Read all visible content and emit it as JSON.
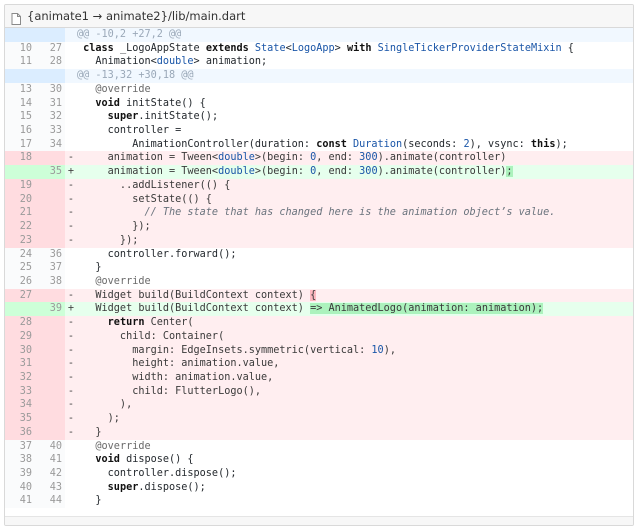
{
  "file": {
    "path": "{animate1 → animate2}/lib/main.dart",
    "icon": "file-icon"
  },
  "colors": {
    "deleted_bg": "#ffeef0",
    "added_bg": "#e6ffed",
    "hunk_bg": "#f1f8ff"
  },
  "lines": [
    {
      "type": "hunk",
      "old": "",
      "new": "",
      "mark": "",
      "code": "@@ -10,2 +27,2 @@"
    },
    {
      "type": "ctx",
      "old": "10",
      "new": "27",
      "mark": "",
      "code": " class _LogoAppState extends State<LogoApp> with SingleTickerProviderStateMixin {"
    },
    {
      "type": "ctx",
      "old": "11",
      "new": "28",
      "mark": "",
      "code": "   Animation<double> animation;"
    },
    {
      "type": "hunk",
      "old": "",
      "new": "",
      "mark": "",
      "code": "@@ -13,32 +30,18 @@"
    },
    {
      "type": "ctx",
      "old": "13",
      "new": "30",
      "mark": "",
      "code": "   @override"
    },
    {
      "type": "ctx",
      "old": "14",
      "new": "31",
      "mark": "",
      "code": "   void initState() {"
    },
    {
      "type": "ctx",
      "old": "15",
      "new": "32",
      "mark": "",
      "code": "     super.initState();"
    },
    {
      "type": "ctx",
      "old": "16",
      "new": "33",
      "mark": "",
      "code": "     controller ="
    },
    {
      "type": "ctx",
      "old": "17",
      "new": "34",
      "mark": "",
      "code": "         AnimationController(duration: const Duration(seconds: 2), vsync: this);"
    },
    {
      "type": "del",
      "old": "18",
      "new": "",
      "mark": "-",
      "code": "     animation = Tween<double>(begin: 0, end: 300).animate(controller)"
    },
    {
      "type": "add",
      "old": "",
      "new": "35",
      "mark": "+",
      "code": "     animation = Tween<double>(begin: 0, end: 300).animate(controller);"
    },
    {
      "type": "del",
      "old": "19",
      "new": "",
      "mark": "-",
      "code": "       ..addListener(() {"
    },
    {
      "type": "del",
      "old": "20",
      "new": "",
      "mark": "-",
      "code": "         setState(() {"
    },
    {
      "type": "del",
      "old": "21",
      "new": "",
      "mark": "-",
      "code": "           // The state that has changed here is the animation object’s value."
    },
    {
      "type": "del",
      "old": "22",
      "new": "",
      "mark": "-",
      "code": "         });"
    },
    {
      "type": "del",
      "old": "23",
      "new": "",
      "mark": "-",
      "code": "       });"
    },
    {
      "type": "ctx",
      "old": "24",
      "new": "36",
      "mark": "",
      "code": "     controller.forward();"
    },
    {
      "type": "ctx",
      "old": "25",
      "new": "37",
      "mark": "",
      "code": "   }"
    },
    {
      "type": "ctx",
      "old": "26",
      "new": "38",
      "mark": "",
      "code": "   @override"
    },
    {
      "type": "del",
      "old": "27",
      "new": "",
      "mark": "-",
      "code": "   Widget build(BuildContext context) {"
    },
    {
      "type": "add",
      "old": "",
      "new": "39",
      "mark": "+",
      "code": "   Widget build(BuildContext context) => AnimatedLogo(animation: animation);"
    },
    {
      "type": "del",
      "old": "28",
      "new": "",
      "mark": "-",
      "code": "     return Center("
    },
    {
      "type": "del",
      "old": "29",
      "new": "",
      "mark": "-",
      "code": "       child: Container("
    },
    {
      "type": "del",
      "old": "30",
      "new": "",
      "mark": "-",
      "code": "         margin: EdgeInsets.symmetric(vertical: 10),"
    },
    {
      "type": "del",
      "old": "31",
      "new": "",
      "mark": "-",
      "code": "         height: animation.value,"
    },
    {
      "type": "del",
      "old": "32",
      "new": "",
      "mark": "-",
      "code": "         width: animation.value,"
    },
    {
      "type": "del",
      "old": "33",
      "new": "",
      "mark": "-",
      "code": "         child: FlutterLogo(),"
    },
    {
      "type": "del",
      "old": "34",
      "new": "",
      "mark": "-",
      "code": "       ),"
    },
    {
      "type": "del",
      "old": "35",
      "new": "",
      "mark": "-",
      "code": "     );"
    },
    {
      "type": "del",
      "old": "36",
      "new": "",
      "mark": "-",
      "code": "   }"
    },
    {
      "type": "ctx",
      "old": "37",
      "new": "40",
      "mark": "",
      "code": "   @override"
    },
    {
      "type": "ctx",
      "old": "38",
      "new": "41",
      "mark": "",
      "code": "   void dispose() {"
    },
    {
      "type": "ctx",
      "old": "39",
      "new": "42",
      "mark": "",
      "code": "     controller.dispose();"
    },
    {
      "type": "ctx",
      "old": "40",
      "new": "43",
      "mark": "",
      "code": "     super.dispose();"
    },
    {
      "type": "ctx",
      "old": "41",
      "new": "44",
      "mark": "",
      "code": "   }"
    }
  ]
}
